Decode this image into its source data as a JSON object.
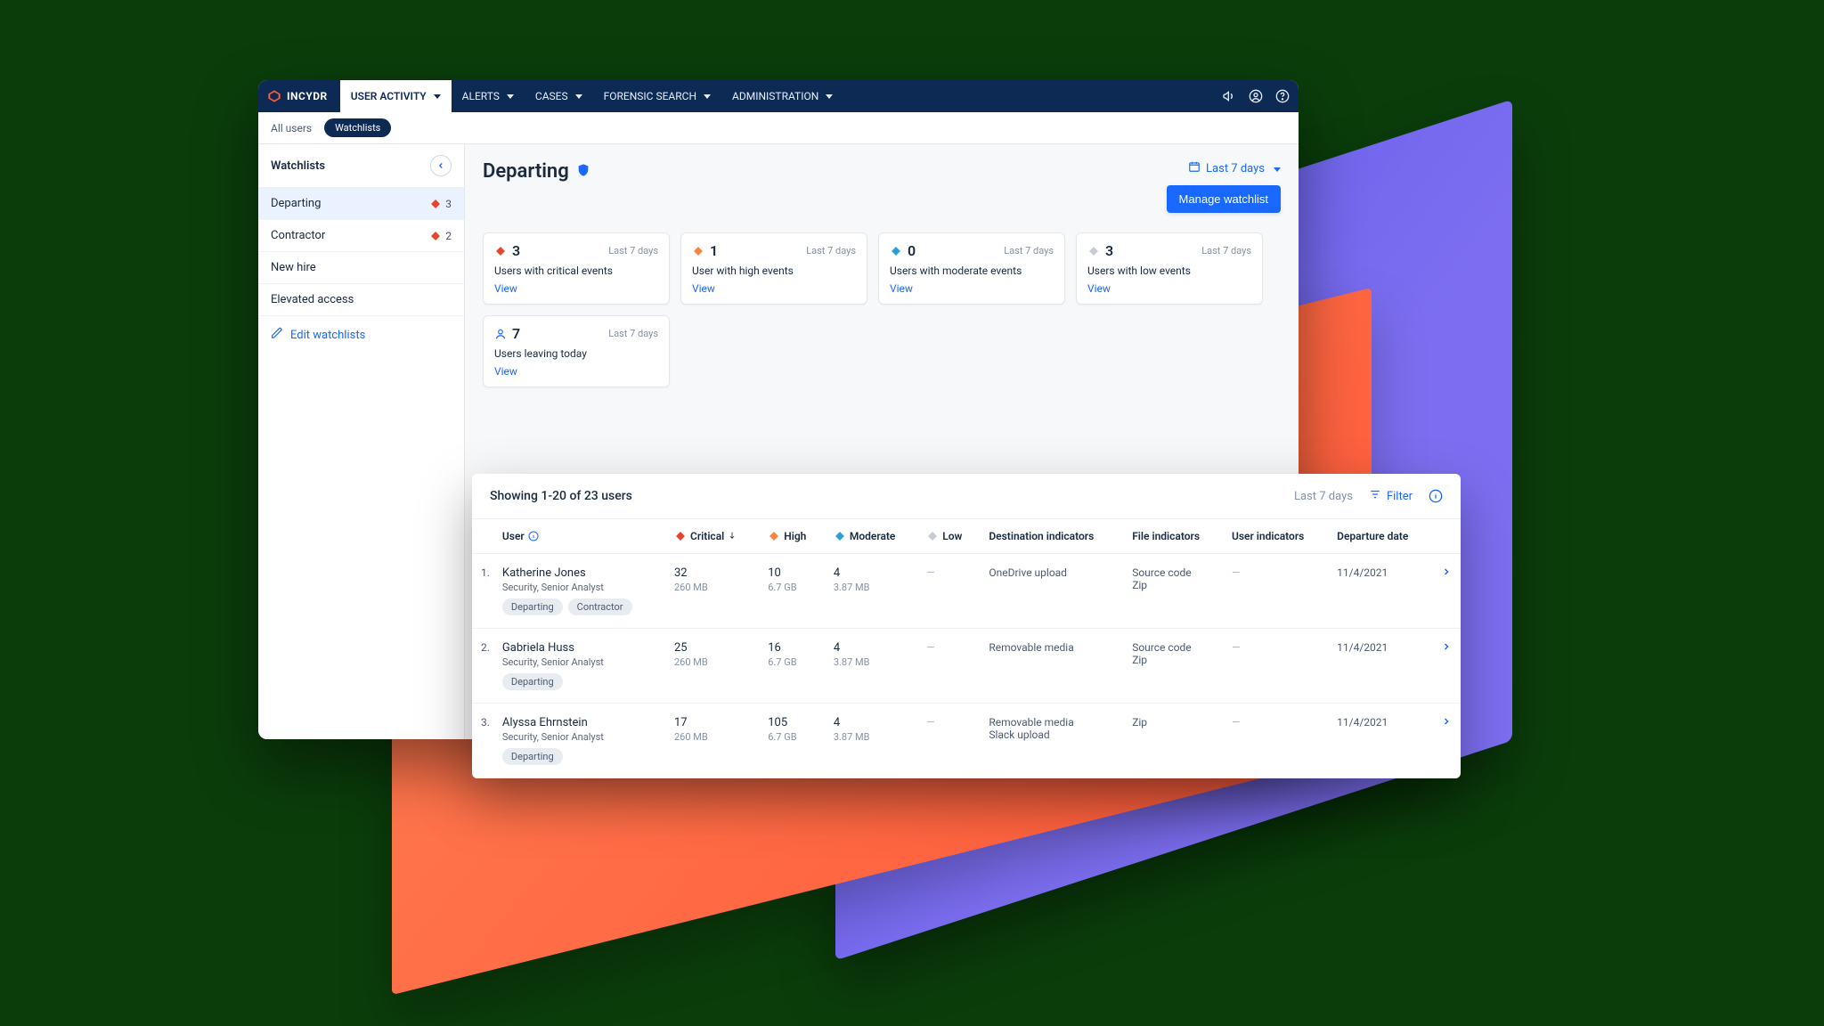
{
  "brand": "INCYDR",
  "nav": {
    "items": [
      "USER ACTIVITY",
      "ALERTS",
      "CASES",
      "FORENSIC SEARCH",
      "ADMINISTRATION"
    ],
    "active": 0
  },
  "subnav": {
    "all_users": "All users",
    "watchlists": "Watchlists"
  },
  "sidebar": {
    "title": "Watchlists",
    "items": [
      {
        "label": "Departing",
        "count": 3,
        "active": true,
        "has_count": true
      },
      {
        "label": "Contractor",
        "count": 2,
        "active": false,
        "has_count": true
      },
      {
        "label": "New hire",
        "active": false,
        "has_count": false
      },
      {
        "label": "Elevated access",
        "active": false,
        "has_count": false
      }
    ],
    "edit": "Edit watchlists"
  },
  "page": {
    "title": "Departing",
    "range_label": "Last 7 days",
    "manage_btn": "Manage watchlist"
  },
  "summary_cards": [
    {
      "icon": "critical",
      "value": "3",
      "label": "Users with critical events",
      "range": "Last 7 days",
      "view": "View"
    },
    {
      "icon": "high",
      "value": "1",
      "label": "User with high events",
      "range": "Last 7 days",
      "view": "View"
    },
    {
      "icon": "moderate",
      "value": "0",
      "label": "Users with moderate events",
      "range": "Last 7 days",
      "view": "View"
    },
    {
      "icon": "low",
      "value": "3",
      "label": "Users with low events",
      "range": "Last 7 days",
      "view": "View"
    },
    {
      "icon": "user",
      "value": "7",
      "label": "Users leaving today",
      "range": "Last 7 days",
      "view": "View"
    }
  ],
  "table": {
    "showing": "Showing 1-20 of 23 users",
    "range": "Last 7 days",
    "filter": "Filter",
    "columns": {
      "user": "User",
      "critical": "Critical",
      "high": "High",
      "moderate": "Moderate",
      "low": "Low",
      "dest": "Destination indicators",
      "file": "File indicators",
      "usr_ind": "User indicators",
      "departure": "Departure date"
    },
    "rows": [
      {
        "idx": "1.",
        "name": "Katherine Jones",
        "role": "Security, Senior Analyst",
        "chips": [
          "Departing",
          "Contractor"
        ],
        "critical": {
          "v": "32",
          "s": "260 MB"
        },
        "high": {
          "v": "10",
          "s": "6.7 GB"
        },
        "moderate": {
          "v": "4",
          "s": "3.87 MB"
        },
        "low_dash": "—",
        "dest": [
          "OneDrive upload"
        ],
        "file": [
          "Source code",
          "Zip"
        ],
        "usr_ind": "—",
        "departure": "11/4/2021"
      },
      {
        "idx": "2.",
        "name": "Gabriela Huss",
        "role": "Security, Senior Analyst",
        "chips": [
          "Departing"
        ],
        "critical": {
          "v": "25",
          "s": "260 MB"
        },
        "high": {
          "v": "16",
          "s": "6.7 GB"
        },
        "moderate": {
          "v": "4",
          "s": "3.87 MB"
        },
        "low_dash": "—",
        "dest": [
          "Removable media"
        ],
        "file": [
          "Source code",
          "Zip"
        ],
        "usr_ind": "—",
        "departure": "11/4/2021"
      },
      {
        "idx": "3.",
        "name": "Alyssa Ehrnstein",
        "role": "Security, Senior Analyst",
        "chips": [
          "Departing"
        ],
        "critical": {
          "v": "17",
          "s": "260 MB"
        },
        "high": {
          "v": "105",
          "s": "6.7 GB"
        },
        "moderate": {
          "v": "4",
          "s": "3.87 MB"
        },
        "low_dash": "—",
        "dest": [
          "Removable media",
          "Slack upload"
        ],
        "file": [
          "Zip"
        ],
        "usr_ind": "—",
        "departure": "11/4/2021"
      }
    ]
  }
}
